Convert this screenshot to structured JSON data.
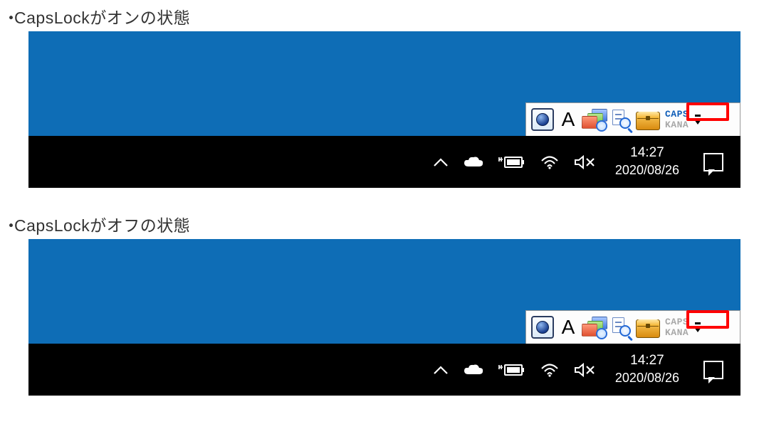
{
  "sections": [
    {
      "caption": "CapsLockがオンの状態",
      "ime": {
        "mode": "A",
        "caps": {
          "label": "CAPS",
          "on": true
        },
        "kana": {
          "label": "KANA",
          "on": false
        }
      },
      "taskbar": {
        "time": "14:27",
        "date": "2020/08/26"
      }
    },
    {
      "caption": "CapsLockがオフの状態",
      "ime": {
        "mode": "A",
        "caps": {
          "label": "CAPS",
          "on": false
        },
        "kana": {
          "label": "KANA",
          "on": false
        }
      },
      "taskbar": {
        "time": "14:27",
        "date": "2020/08/26"
      }
    }
  ]
}
